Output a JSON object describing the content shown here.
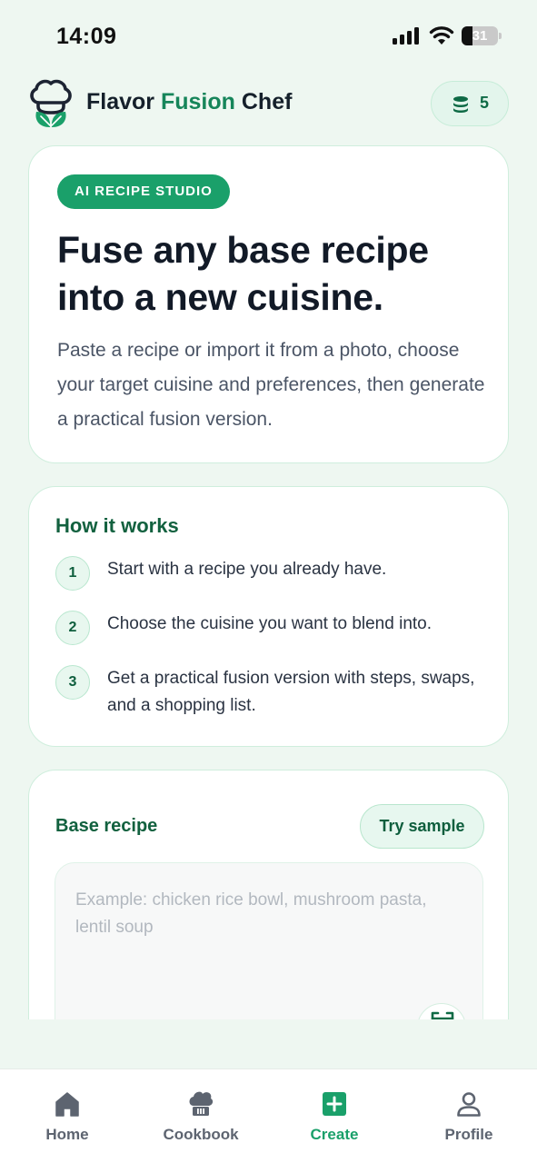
{
  "status_bar": {
    "time": "14:09",
    "battery": "31",
    "battery_level": 0.31
  },
  "header": {
    "title_part1": "Flavor ",
    "title_accent": "Fusion",
    "title_part2": " Chef",
    "credits": "5",
    "credits_icon": "database-icon",
    "logo_icon": "chef-hat-leaf-icon"
  },
  "hero": {
    "badge": "AI RECIPE STUDIO",
    "title": "Fuse any base recipe into a new cuisine.",
    "description": "Paste a recipe or import it from a photo, choose your target cuisine and preferences, then generate a practical fusion version."
  },
  "how_it_works": {
    "title": "How it works",
    "steps": [
      {
        "number": "1",
        "text": "Start with a recipe you already have."
      },
      {
        "number": "2",
        "text": "Choose the cuisine you want to blend into."
      },
      {
        "number": "3",
        "text": "Get a practical fusion version with steps, swaps, and a shopping list."
      }
    ]
  },
  "base_recipe": {
    "title": "Base recipe",
    "try_sample": "Try sample",
    "placeholder": "Example: chicken rice bowl, mushroom pasta, lentil soup",
    "scan_icon": "scan-icon"
  },
  "nav": {
    "items": [
      {
        "label": "Home",
        "icon": "home-icon"
      },
      {
        "label": "Cookbook",
        "icon": "chef-hat-icon"
      },
      {
        "label": "Create",
        "icon": "plus-square-icon"
      },
      {
        "label": "Profile",
        "icon": "user-icon"
      }
    ],
    "active": "Create"
  },
  "colors": {
    "accent": "#1aa06a",
    "accent_dark": "#12613f",
    "background": "#eef7f1",
    "card_border": "#cfeedd"
  }
}
